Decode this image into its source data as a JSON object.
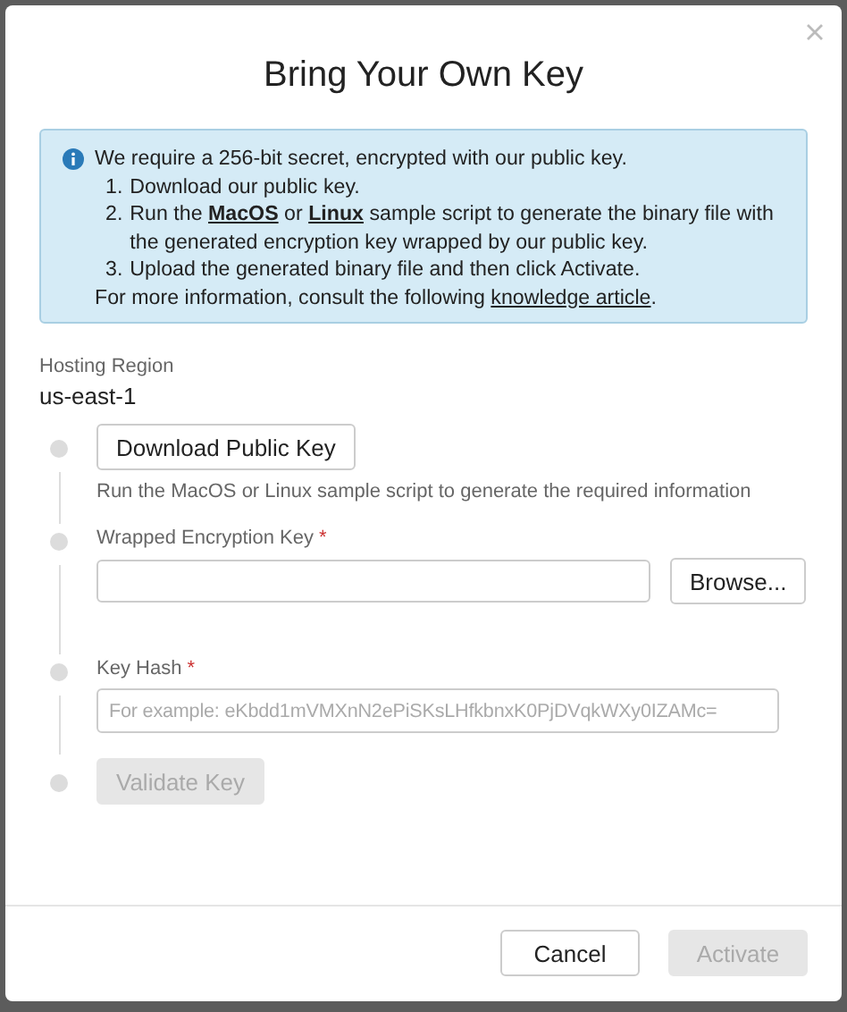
{
  "dialog": {
    "title": "Bring Your Own Key"
  },
  "info": {
    "intro": "We require a 256-bit secret, encrypted with our public key.",
    "steps": [
      {
        "number": "1.",
        "segments": [
          {
            "kind": "text",
            "text": "Download our public key."
          }
        ]
      },
      {
        "number": "2.",
        "segments": [
          {
            "kind": "text",
            "text": "Run the "
          },
          {
            "kind": "link",
            "text": "MacOS"
          },
          {
            "kind": "text",
            "text": " or "
          },
          {
            "kind": "link",
            "text": "Linux"
          },
          {
            "kind": "text",
            "text": " sample script to generate the binary file with the generated encryption key wrapped by our public key."
          }
        ]
      },
      {
        "number": "3.",
        "segments": [
          {
            "kind": "text",
            "text": "Upload the generated binary file and then click Activate."
          }
        ]
      }
    ],
    "footer": [
      {
        "kind": "text",
        "text": "For more information, consult the following "
      },
      {
        "kind": "link",
        "text": "knowledge article"
      },
      {
        "kind": "text",
        "text": "."
      }
    ]
  },
  "region": {
    "label": "Hosting Region",
    "value": "us-east-1"
  },
  "steps": [
    {
      "kind": "button",
      "label": "Download Public Key",
      "disabled": false,
      "hint": "Run the MacOS or Linux sample script to generate the required information"
    },
    {
      "kind": "file",
      "label": "Wrapped Encryption Key",
      "required_mark": "*",
      "button": "Browse..."
    },
    {
      "kind": "field",
      "label": "Key Hash",
      "required_mark": "*",
      "placeholder": "For example: eKbdd1mVMXnN2ePiSKsLHfkbnxK0PjDVqkWXy0IZAMc="
    },
    {
      "kind": "button",
      "label": "Validate Key",
      "disabled": true
    }
  ],
  "buttons": [
    {
      "label": "Cancel",
      "disabled": false
    },
    {
      "label": "Activate",
      "disabled": true
    }
  ]
}
